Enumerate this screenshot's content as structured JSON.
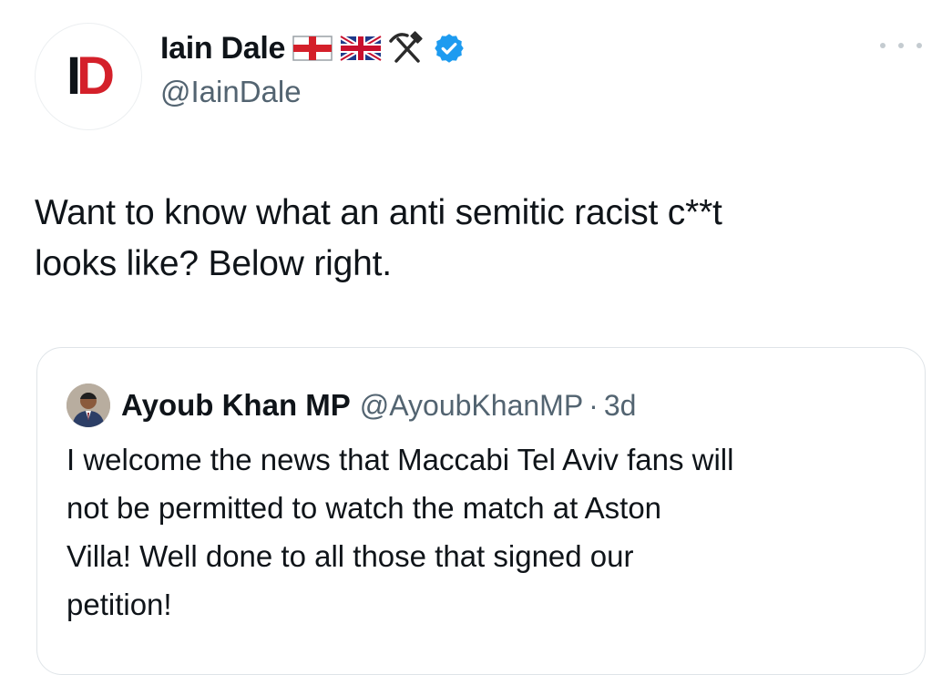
{
  "author": {
    "display_name": "Iain Dale",
    "handle": "@IainDale",
    "avatar_logo": {
      "letter1": "I",
      "letter2": "D"
    },
    "badges": [
      "england-flag-icon",
      "union-jack-icon",
      "hammer-pick-icon",
      "verified-badge-icon"
    ]
  },
  "tweet": {
    "text_line1": "Want to know what an anti semitic racist c**t",
    "text_line2": "looks like? Below right."
  },
  "quoted": {
    "display_name": "Ayoub Khan MP",
    "handle": "@AyoubKhanMP",
    "separator": "·",
    "time": "3d",
    "text_line1": "I welcome the news that Maccabi Tel Aviv fans will",
    "text_line2": "not be permitted to watch the match at Aston",
    "text_line3": "Villa! Well done to all those that signed our",
    "text_line4": "petition!"
  },
  "colors": {
    "accent_blue": "#1d9bf0",
    "logo_red": "#d4202a",
    "secondary_text": "#536471"
  }
}
